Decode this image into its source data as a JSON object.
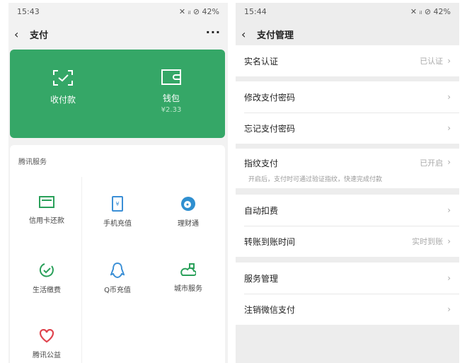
{
  "left": {
    "status_time": "15:43",
    "status_right": "✕ ᵢₗ ⊘ 42%",
    "title": "支付",
    "more": "···",
    "actions": [
      {
        "label": "收付款"
      },
      {
        "label": "钱包",
        "sub": "¥2.33"
      }
    ],
    "services_title": "腾讯服务",
    "services": [
      {
        "label": "信用卡还款",
        "color": "#2aa05a"
      },
      {
        "label": "手机充值",
        "color": "#3b8fd6"
      },
      {
        "label": "理财通",
        "color": "#2f8fd0"
      },
      {
        "label": "生活缴费",
        "color": "#2aa05a"
      },
      {
        "label": "Q币充值",
        "color": "#3b8fd6"
      },
      {
        "label": "城市服务",
        "color": "#2aa05a"
      },
      {
        "label": "腾讯公益",
        "color": "#e0454f"
      }
    ]
  },
  "right": {
    "status_time": "15:44",
    "status_right": "✕ ᵢₗ ⊘ 42%",
    "title": "支付管理",
    "rows": [
      {
        "label": "实名认证",
        "value": "已认证"
      },
      {
        "label": "修改支付密码",
        "value": ""
      },
      {
        "label": "忘记支付密码",
        "value": ""
      },
      {
        "label": "指纹支付",
        "value": "已开启",
        "sub": "开启后，支付时可通过验证指纹，快速完成付款"
      },
      {
        "label": "自动扣费",
        "value": ""
      },
      {
        "label": "转账到账时间",
        "value": "实时到账"
      },
      {
        "label": "服务管理",
        "value": ""
      },
      {
        "label": "注销微信支付",
        "value": ""
      }
    ]
  }
}
